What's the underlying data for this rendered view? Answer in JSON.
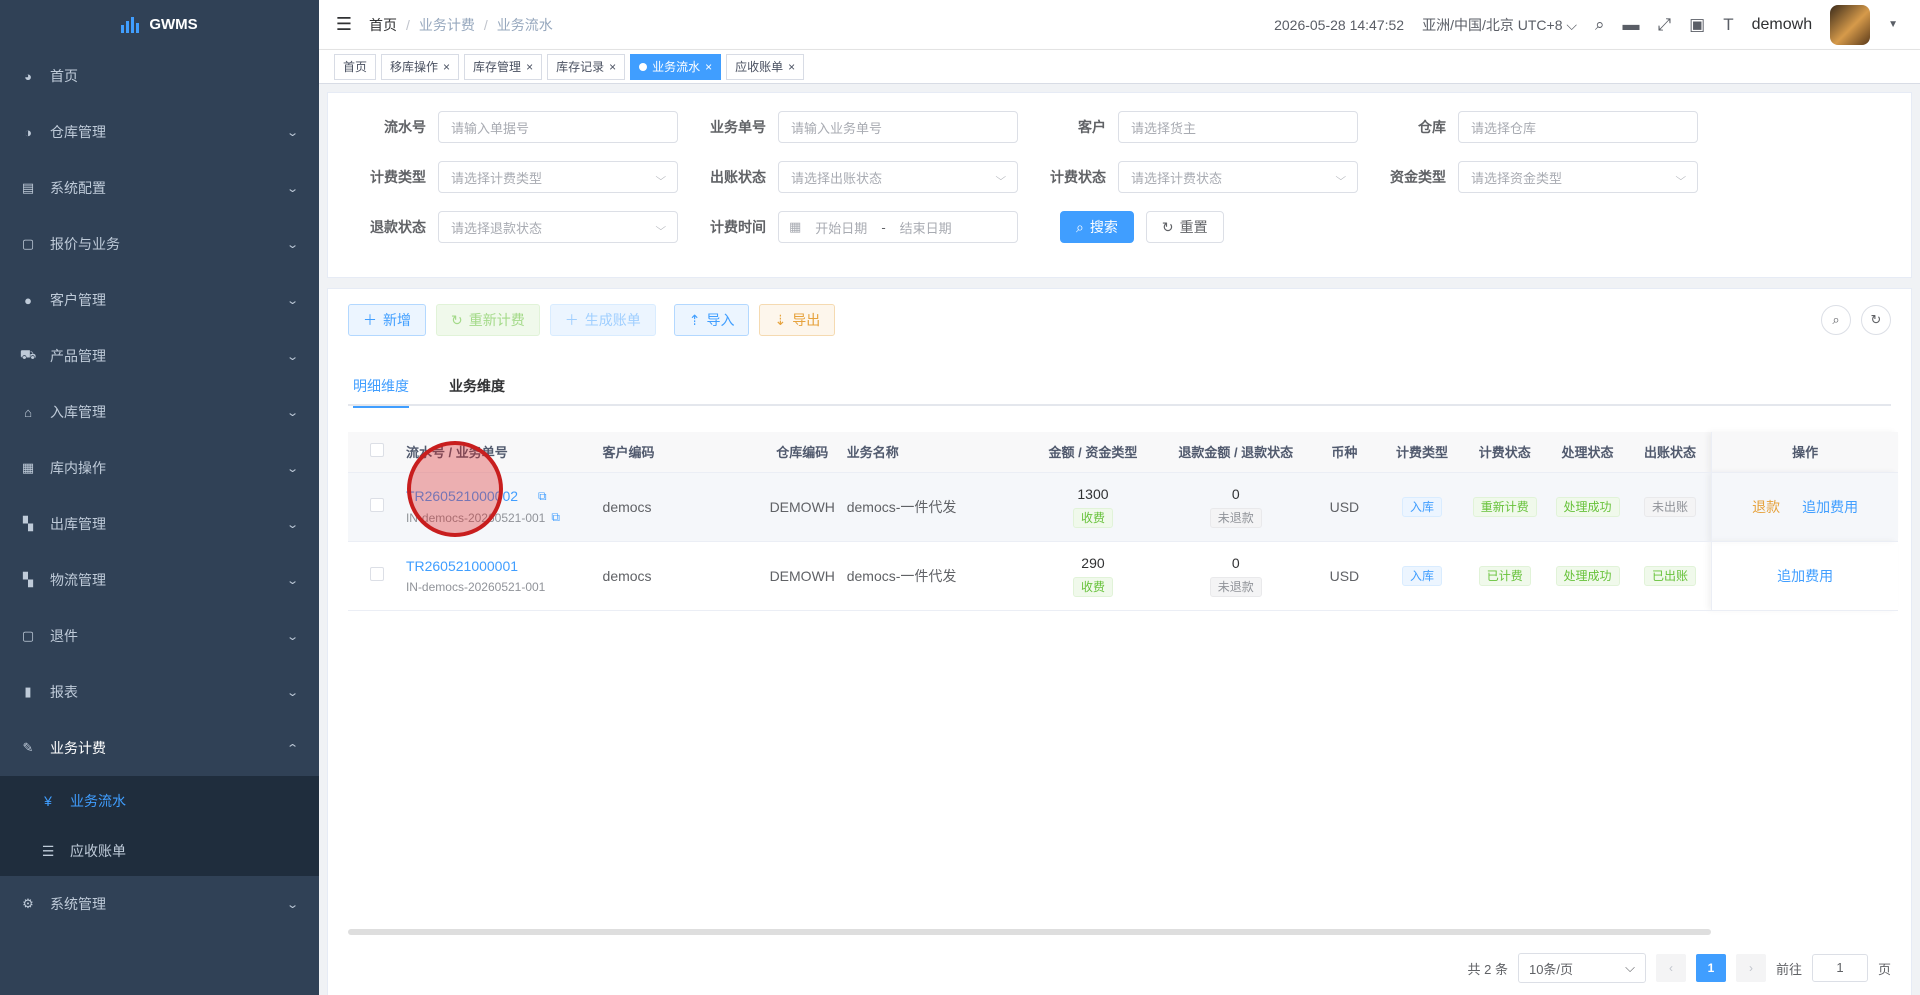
{
  "app": {
    "logo_text": "GWMS"
  },
  "sidebar": {
    "items": [
      {
        "label": "首页",
        "icon": "dashboard-icon",
        "glyph": "◕",
        "chevron": false
      },
      {
        "label": "仓库管理",
        "icon": "warehouse-icon",
        "glyph": "◑",
        "chevron": true
      },
      {
        "label": "系统配置",
        "icon": "system-config-icon",
        "glyph": "▤",
        "chevron": true
      },
      {
        "label": "报价与业务",
        "icon": "quote-icon",
        "glyph": "▢",
        "chevron": true
      },
      {
        "label": "客户管理",
        "icon": "customer-icon",
        "glyph": "●",
        "chevron": true
      },
      {
        "label": "产品管理",
        "icon": "cart-icon",
        "glyph": "⛟",
        "chevron": true
      },
      {
        "label": "入库管理",
        "icon": "home-icon",
        "glyph": "⌂",
        "chevron": true
      },
      {
        "label": "库内操作",
        "icon": "grid-icon",
        "glyph": "▦",
        "chevron": true
      },
      {
        "label": "出库管理",
        "icon": "apps-icon",
        "glyph": "▚",
        "chevron": true
      },
      {
        "label": "物流管理",
        "icon": "apps-icon",
        "glyph": "▚",
        "chevron": true
      },
      {
        "label": "退件",
        "icon": "return-icon",
        "glyph": "▢",
        "chevron": true
      },
      {
        "label": "报表",
        "icon": "chart-icon",
        "glyph": "▮",
        "chevron": true
      },
      {
        "label": "业务计费",
        "icon": "edit-icon",
        "glyph": "✎",
        "chevron": true,
        "open": true
      }
    ],
    "submenu": [
      {
        "label": "业务流水",
        "icon": "yen-icon",
        "glyph": "¥",
        "active": true
      },
      {
        "label": "应收账单",
        "icon": "list-icon",
        "glyph": "☰",
        "active": false
      }
    ],
    "footer_item": {
      "label": "系统管理",
      "icon": "gear-icon",
      "glyph": "⚙"
    }
  },
  "header": {
    "breadcrumb": [
      "首页",
      "业务计费",
      "业务流水"
    ],
    "datetime": "2026-05-28 14:47:52",
    "timezone": "亚洲/中国/北京 UTC+8",
    "username": "demowh"
  },
  "tags": [
    {
      "label": "首页",
      "closable": false,
      "active": false
    },
    {
      "label": "移库操作",
      "closable": true,
      "active": false
    },
    {
      "label": "库存管理",
      "closable": true,
      "active": false
    },
    {
      "label": "库存记录",
      "closable": true,
      "active": false
    },
    {
      "label": "业务流水",
      "closable": true,
      "active": true
    },
    {
      "label": "应收账单",
      "closable": true,
      "active": false
    }
  ],
  "search": {
    "flow_no": {
      "label": "流水号",
      "placeholder": "请输入单据号"
    },
    "biz_no": {
      "label": "业务单号",
      "placeholder": "请输入业务单号"
    },
    "customer": {
      "label": "客户",
      "placeholder": "请选择货主"
    },
    "warehouse": {
      "label": "仓库",
      "placeholder": "请选择仓库"
    },
    "fee_type": {
      "label": "计费类型",
      "placeholder": "请选择计费类型"
    },
    "bill_status": {
      "label": "出账状态",
      "placeholder": "请选择出账状态"
    },
    "charge_status": {
      "label": "计费状态",
      "placeholder": "请选择计费状态"
    },
    "fund_type": {
      "label": "资金类型",
      "placeholder": "请选择资金类型"
    },
    "refund_status": {
      "label": "退款状态",
      "placeholder": "请选择退款状态"
    },
    "charge_time": {
      "label": "计费时间",
      "start": "开始日期",
      "sep": "-",
      "end": "结束日期"
    },
    "search_label": "搜索",
    "reset_label": "重置"
  },
  "toolbar": {
    "add": "新增",
    "recalc": "重新计费",
    "gen_bill": "生成账单",
    "import": "导入",
    "export": "导出"
  },
  "tabs": [
    "明细维度",
    "业务维度"
  ],
  "table": {
    "columns": [
      "流水号 / 业务单号",
      "客户编码",
      "仓库编码",
      "业务名称",
      "金额 / 资金类型",
      "退款金额 / 退款状态",
      "币种",
      "计费类型",
      "计费状态",
      "处理状态",
      "出账状态",
      "操作"
    ],
    "rows": [
      {
        "flow_no": "TR260521000002",
        "biz_no": "IN-democs-20260521-001",
        "customer": "democs",
        "warehouse": "DEMOWH",
        "biz_name": "democs-一件代发",
        "amount": "1300",
        "fund_type": "收费",
        "refund_amount": "0",
        "refund_status": "未退款",
        "currency": "USD",
        "fee_type": "入库",
        "charge_status": "重新计费",
        "process_status": "处理成功",
        "bill_status": "未出账",
        "ops": [
          "退款",
          "追加费用"
        ]
      },
      {
        "flow_no": "TR260521000001",
        "biz_no": "IN-democs-20260521-001",
        "customer": "democs",
        "warehouse": "DEMOWH",
        "biz_name": "democs-一件代发",
        "amount": "290",
        "fund_type": "收费",
        "refund_amount": "0",
        "refund_status": "未退款",
        "currency": "USD",
        "fee_type": "入库",
        "charge_status": "已计费",
        "process_status": "处理成功",
        "bill_status": "已出账",
        "ops": [
          "追加费用"
        ]
      }
    ]
  },
  "pagination": {
    "total": "共 2 条",
    "page_size": "10条/页",
    "current": "1",
    "goto_prefix": "前往",
    "goto_value": "1",
    "goto_suffix": "页"
  },
  "colors": {
    "primary": "#409eff",
    "sidebar": "#304156",
    "success": "#67c23a",
    "warning": "#e6a23c"
  }
}
